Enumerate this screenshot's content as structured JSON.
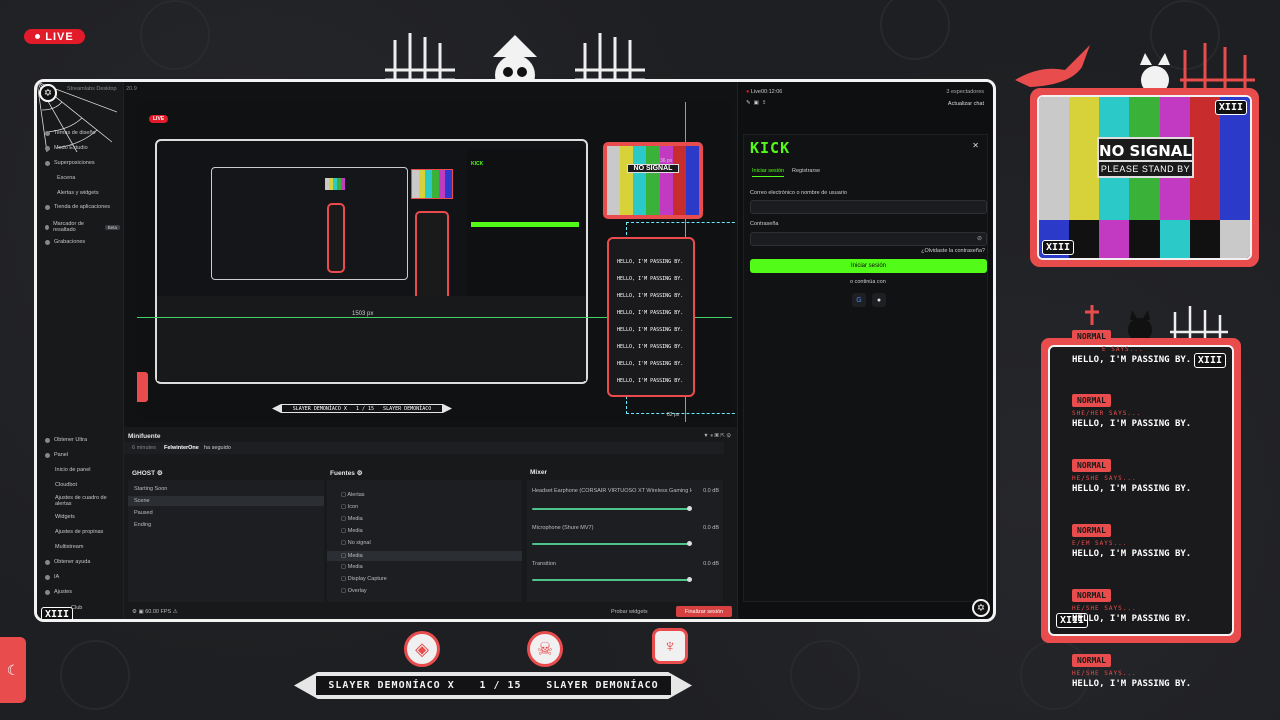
{
  "live_badge": "LIVE",
  "app": {
    "title": "Streamlabs Desktop",
    "version": "20.9",
    "sidebar_top": [
      {
        "label": "Temas de diseño"
      },
      {
        "label": "Modo Estudio"
      },
      {
        "label": "Superposiciones"
      },
      {
        "label": "Escena"
      },
      {
        "label": "Alertas y widgets"
      },
      {
        "label": "Tienda de aplicaciones"
      },
      {
        "label": "Marcador de resaltado",
        "badge": "Beta"
      },
      {
        "label": "Grabaciones"
      }
    ],
    "sidebar_bottom": [
      {
        "label": "Obtener Ultra"
      },
      {
        "label": "Panel"
      },
      {
        "label": "Inicio de panel"
      },
      {
        "label": "Cloudbot"
      },
      {
        "label": "Ajustes de cuadro de alertas"
      },
      {
        "label": "Widgets"
      },
      {
        "label": "Ajustes de propinas"
      },
      {
        "label": "Multistream"
      },
      {
        "label": "Obtener ayuda"
      },
      {
        "label": "IA"
      },
      {
        "label": "Ajustes"
      },
      {
        "label": "Club"
      }
    ],
    "preview": {
      "live": "LIVE",
      "size_label": "1503 px",
      "small_label": "36 px",
      "small_label2": "82 px"
    },
    "chat": {
      "live_time": "Live00:12:06",
      "viewers": "3 espectadores",
      "refresh": "Actualizar chat",
      "kick_logo": "KICK",
      "tab_login": "Iniciar sesión",
      "tab_register": "Registrarse",
      "email_label": "Correo electrónico o nombre de usuario",
      "password_label": "Contraseña",
      "forgot": "¿Olvidaste la contraseña?",
      "login_button": "Iniciar sesión",
      "continue_with": "o continúa con",
      "google": "G",
      "apple": "●"
    },
    "minifeed": {
      "title": "Minifuente",
      "time": "6 minutes",
      "user": "FelwinterOne",
      "action": "ha seguido"
    },
    "scenes": {
      "title": "GHOST",
      "items": [
        "Starting Soon",
        "Scene",
        "Paused",
        "Ending"
      ]
    },
    "sources": {
      "title": "Fuentes",
      "items": [
        "Alertas",
        "Icon",
        "Media",
        "Media",
        "No signal",
        "Media",
        "Media",
        "Display Capture",
        "Overlay"
      ]
    },
    "mixer": {
      "title": "Mixer",
      "channels": [
        {
          "name": "Headset Earphone (CORSAIR VIRTUOSO XT Wireless Gaming Head...",
          "db": "0.0 dB",
          "level": 1.0
        },
        {
          "name": "Microphone (Shure MV7)",
          "db": "0.0 dB",
          "level": 1.0
        },
        {
          "name": "Transition",
          "db": "0.0 dB",
          "level": 1.0
        }
      ]
    },
    "footer": {
      "fps": "60.00 FPS",
      "test_widgets": "Probar widgets",
      "end_stream": "Finalizar sesión"
    }
  },
  "tv": {
    "line1": "NO SIGNAL",
    "line2": "PLEASE STAND BY",
    "bar_colors": [
      "#c9c9c9",
      "#d8d23a",
      "#2cc9c9",
      "#3ab23a",
      "#c23ac2",
      "#c92c2c",
      "#2c3ac9"
    ],
    "bottom_colors": [
      "#2c3ac9",
      "#111",
      "#c23ac2",
      "#111",
      "#2cc9c9",
      "#111",
      "#c9c9c9"
    ]
  },
  "xiii": "XIII",
  "chat_widget": {
    "messages": [
      {
        "tag": "NORMAL",
        "pronoun": "E SAYS...",
        "text": "HELLO, I'M PASSING BY."
      },
      {
        "tag": "NORMAL",
        "pronoun": "SHE/HER SAYS...",
        "text": "HELLO, I'M PASSING BY."
      },
      {
        "tag": "NORMAL",
        "pronoun": "HE/SHE SAYS...",
        "text": "HELLO, I'M PASSING BY."
      },
      {
        "tag": "NORMAL",
        "pronoun": "E/EM SAYS...",
        "text": "HELLO, I'M PASSING BY."
      },
      {
        "tag": "NORMAL",
        "pronoun": "HE/SHE SAYS...",
        "text": "HELLO, I'M PASSING BY."
      },
      {
        "tag": "NORMAL",
        "pronoun": "HE/SHE SAYS...",
        "text": "HELLO, I'M PASSING BY."
      }
    ]
  },
  "bottom_bar": {
    "left": "SLAYER DEMONÍACO X",
    "count": "1 / 15",
    "right": "SLAYER DEMONÍACO"
  },
  "moon_icon": "☾",
  "accent": "#e94c4c",
  "kick_green": "#53fc18"
}
